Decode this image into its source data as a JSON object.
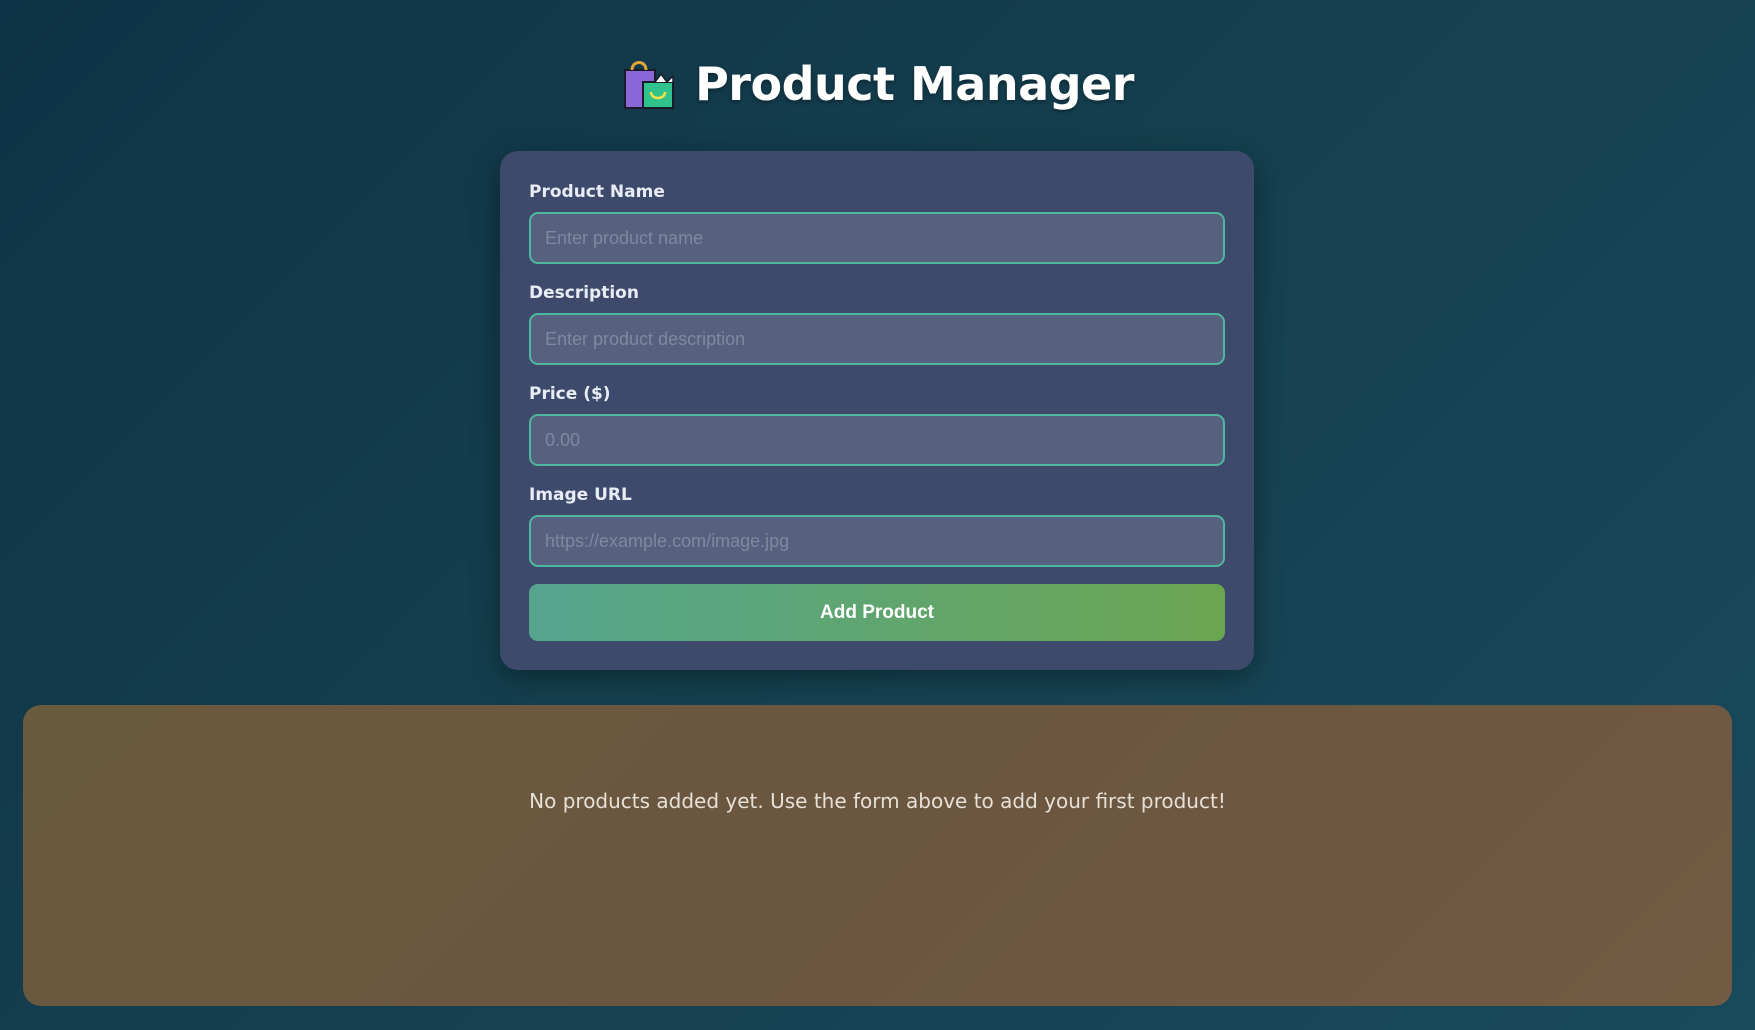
{
  "header": {
    "icon": "shopping-bags-icon",
    "title": "Product Manager"
  },
  "form": {
    "fields": [
      {
        "label": "Product Name",
        "placeholder": "Enter product name",
        "value": ""
      },
      {
        "label": "Description",
        "placeholder": "Enter product description",
        "value": ""
      },
      {
        "label": "Price ($)",
        "placeholder": "0.00",
        "value": ""
      },
      {
        "label": "Image URL",
        "placeholder": "https://example.com/image.jpg",
        "value": ""
      }
    ],
    "submit_label": "Add Product"
  },
  "products": {
    "items": [],
    "empty_message": "No products added yet. Use the form above to add your first product!"
  },
  "colors": {
    "accent_border": "#4fb79e",
    "button_gradient_start": "#55a58f",
    "button_gradient_end": "#6aa550",
    "card_background": "#3e4a6b",
    "panel_background": "#6b5640"
  }
}
